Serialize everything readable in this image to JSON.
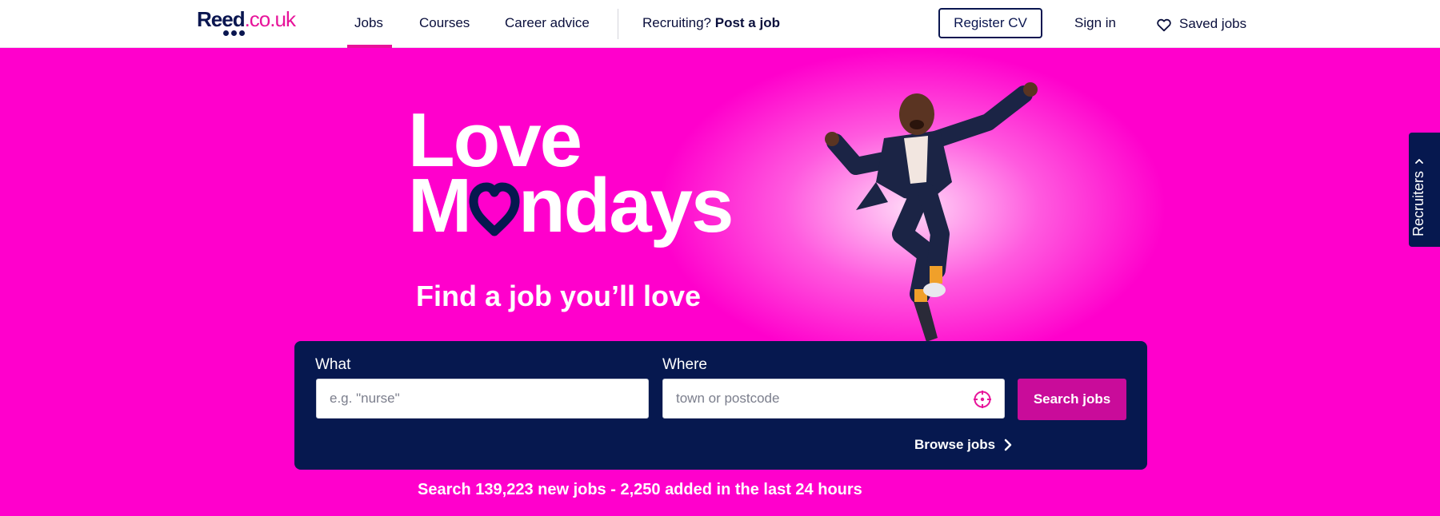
{
  "header": {
    "logo": {
      "main": "Reed",
      "domain": ".co.uk"
    },
    "nav": {
      "jobs": "Jobs",
      "courses": "Courses",
      "career_advice": "Career advice",
      "recruiting_prefix": "Recruiting?",
      "post_a_job": "Post a job"
    },
    "register_cv": "Register CV",
    "sign_in": "Sign in",
    "saved_jobs": "Saved jobs",
    "icons": {
      "saved": "heart-outline-icon"
    }
  },
  "hero": {
    "headline_line1": "Love",
    "headline_line2_start": "M",
    "headline_line2_end": "ndays",
    "tagline": "Find a job you’ll love",
    "colors": {
      "background": "#ff00cc",
      "panel": "#06184f",
      "button": "#c90c9a",
      "heart": "#06184f"
    }
  },
  "search": {
    "what_label": "What",
    "what_placeholder": "e.g. \"nurse\"",
    "where_label": "Where",
    "where_placeholder": "town or postcode",
    "search_button": "Search jobs",
    "browse_jobs": "Browse jobs",
    "icons": {
      "locate": "crosshair-locate-icon",
      "browse": "chevron-right-icon"
    }
  },
  "stats_text": "Search 139,223 new jobs - 2,250 added in the last 24 hours",
  "side_tab": {
    "label": "Recruiters",
    "icon": "chevron-up-icon"
  }
}
